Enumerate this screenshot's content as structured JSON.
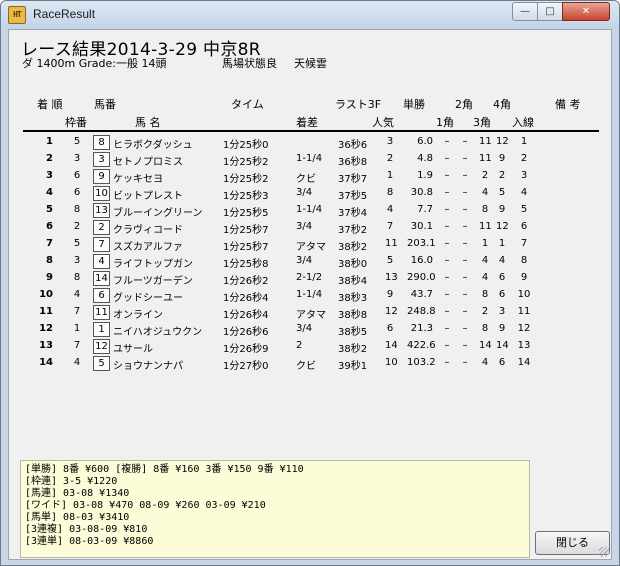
{
  "window": {
    "title": "RaceResult",
    "app_icon_text": "HT",
    "buttons": {
      "minimize": "—",
      "maximize": "□",
      "close": "✕"
    }
  },
  "race": {
    "heading": "レース結果2014-3-29 中京8R",
    "info": "ダ 1400m Grade:一般 14頭",
    "condition": "馬場状態良",
    "weather": "天候雲"
  },
  "headers": {
    "chakujun": "着 順",
    "umaban": "馬番",
    "time": "タイム",
    "last3f": "ラスト3F",
    "tansho": "単勝",
    "corner2": "2角",
    "corner4": "4角",
    "biko": "備 考",
    "wakuban": "枠番",
    "bamei": "馬 名",
    "chakusa": "着差",
    "ninki": "人気",
    "corner1": "1角",
    "corner3": "3角",
    "nyusen": "入線"
  },
  "rows": [
    {
      "rank": "1",
      "waku": "5",
      "umaban": "8",
      "name": "ヒラボクダッシュ",
      "time": "1分25秒0",
      "margin": "",
      "last3f": "36秒6",
      "ninki": "3",
      "odds": "6.0",
      "c1": "–",
      "c2": "–",
      "c3": "11",
      "c4": "12",
      "nyusen": "1"
    },
    {
      "rank": "2",
      "waku": "3",
      "umaban": "3",
      "name": "セトノプロミス",
      "time": "1分25秒2",
      "margin": "1-1/4",
      "last3f": "36秒8",
      "ninki": "2",
      "odds": "4.8",
      "c1": "–",
      "c2": "–",
      "c3": "11",
      "c4": "9",
      "nyusen": "2"
    },
    {
      "rank": "3",
      "waku": "6",
      "umaban": "9",
      "name": "ケッキセヨ",
      "time": "1分25秒2",
      "margin": "クビ",
      "last3f": "37秒7",
      "ninki": "1",
      "odds": "1.9",
      "c1": "–",
      "c2": "–",
      "c3": "2",
      "c4": "2",
      "nyusen": "3"
    },
    {
      "rank": "4",
      "waku": "6",
      "umaban": "10",
      "name": "ビットプレスト",
      "time": "1分25秒3",
      "margin": "3/4",
      "last3f": "37秒5",
      "ninki": "8",
      "odds": "30.8",
      "c1": "–",
      "c2": "–",
      "c3": "4",
      "c4": "5",
      "nyusen": "4"
    },
    {
      "rank": "5",
      "waku": "8",
      "umaban": "13",
      "name": "ブルーイングリーン",
      "time": "1分25秒5",
      "margin": "1-1/4",
      "last3f": "37秒4",
      "ninki": "4",
      "odds": "7.7",
      "c1": "–",
      "c2": "–",
      "c3": "8",
      "c4": "9",
      "nyusen": "5"
    },
    {
      "rank": "6",
      "waku": "2",
      "umaban": "2",
      "name": "クラヴィコード",
      "time": "1分25秒7",
      "margin": "3/4",
      "last3f": "37秒2",
      "ninki": "7",
      "odds": "30.1",
      "c1": "–",
      "c2": "–",
      "c3": "11",
      "c4": "12",
      "nyusen": "6"
    },
    {
      "rank": "7",
      "waku": "5",
      "umaban": "7",
      "name": "スズカアルファ",
      "time": "1分25秒7",
      "margin": "アタマ",
      "last3f": "38秒2",
      "ninki": "11",
      "odds": "203.1",
      "c1": "–",
      "c2": "–",
      "c3": "1",
      "c4": "1",
      "nyusen": "7"
    },
    {
      "rank": "8",
      "waku": "3",
      "umaban": "4",
      "name": "ライフトップガン",
      "time": "1分25秒8",
      "margin": "3/4",
      "last3f": "38秒0",
      "ninki": "5",
      "odds": "16.0",
      "c1": "–",
      "c2": "–",
      "c3": "4",
      "c4": "4",
      "nyusen": "8"
    },
    {
      "rank": "9",
      "waku": "8",
      "umaban": "14",
      "name": "フルーツガーデン",
      "time": "1分26秒2",
      "margin": "2-1/2",
      "last3f": "38秒4",
      "ninki": "13",
      "odds": "290.0",
      "c1": "–",
      "c2": "–",
      "c3": "4",
      "c4": "6",
      "nyusen": "9"
    },
    {
      "rank": "10",
      "waku": "4",
      "umaban": "6",
      "name": "グッドシーユー",
      "time": "1分26秒4",
      "margin": "1-1/4",
      "last3f": "38秒3",
      "ninki": "9",
      "odds": "43.7",
      "c1": "–",
      "c2": "–",
      "c3": "8",
      "c4": "6",
      "nyusen": "10"
    },
    {
      "rank": "11",
      "waku": "7",
      "umaban": "11",
      "name": "オンライン",
      "time": "1分26秒4",
      "margin": "アタマ",
      "last3f": "38秒8",
      "ninki": "12",
      "odds": "248.8",
      "c1": "–",
      "c2": "–",
      "c3": "2",
      "c4": "3",
      "nyusen": "11"
    },
    {
      "rank": "12",
      "waku": "1",
      "umaban": "1",
      "name": "ニイハオジュウクン",
      "time": "1分26秒6",
      "margin": "3/4",
      "last3f": "38秒5",
      "ninki": "6",
      "odds": "21.3",
      "c1": "–",
      "c2": "–",
      "c3": "8",
      "c4": "9",
      "nyusen": "12"
    },
    {
      "rank": "13",
      "waku": "7",
      "umaban": "12",
      "name": "ユサール",
      "time": "1分26秒9",
      "margin": "2",
      "last3f": "38秒2",
      "ninki": "14",
      "odds": "422.6",
      "c1": "–",
      "c2": "–",
      "c3": "14",
      "c4": "14",
      "nyusen": "13"
    },
    {
      "rank": "14",
      "waku": "4",
      "umaban": "5",
      "name": "ショウナンナパ",
      "time": "1分27秒0",
      "margin": "クビ",
      "last3f": "39秒1",
      "ninki": "10",
      "odds": "103.2",
      "c1": "–",
      "c2": "–",
      "c3": "4",
      "c4": "6",
      "nyusen": "14"
    }
  ],
  "payouts": [
    "[単勝] 8番 ¥600    [複勝] 8番 ¥160  3番 ¥150  9番 ¥110",
    "[枠連] 3-5 ¥1220",
    "[馬連] 03-08 ¥1340",
    "[ワイド] 03-08 ¥470  08-09 ¥260  03-09 ¥210",
    "[馬単] 08-03 ¥3410",
    "[3連複] 03-08-09 ¥810",
    "[3連単] 08-03-09 ¥8860"
  ],
  "close_button_label": "閉じる"
}
